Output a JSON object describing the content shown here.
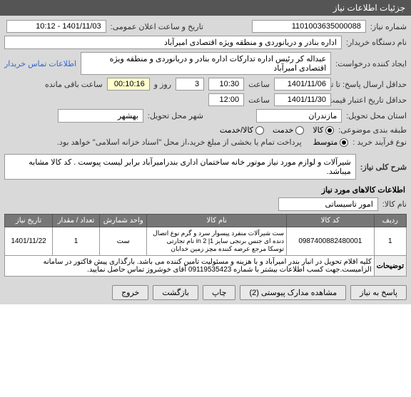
{
  "header": {
    "title": "جزئیات اطلاعات نیاز"
  },
  "form": {
    "need_number_label": "شماره نیاز:",
    "need_number_value": "1101003635000088",
    "public_announce_label": "تاریخ و ساعت اعلان عمومی:",
    "public_announce_value": "1401/11/03 - 10:12",
    "buyer_org_label": "نام دستگاه خریدار:",
    "buyer_org_value": "اداره بنادر و دریانوردی و منطقه ویژه اقتصادی امیرآباد",
    "requester_label": "ایجاد کننده درخواست:",
    "requester_value": "عبداله کر رئیس اداره تدارکات اداره بنادر و دریانوردی و منطقه ویژه اقتصادی امیرآباد",
    "buyer_contact_link": "اطلاعات تماس خریدار",
    "response_deadline_label": "حداقل ارسال پاسخ: تا تاریخ:",
    "response_date": "1401/11/06",
    "response_time_label": "ساعت",
    "response_time": "10:30",
    "days_label": "روز و",
    "days_value": "3",
    "remaining_time": "00:10:16",
    "remaining_label": "ساعت باقی مانده",
    "validity_label": "حداقل تاریخ اعتبار قیمت: تا تاریخ:",
    "validity_date": "1401/11/30",
    "validity_time_label": "ساعت",
    "validity_time": "12:00",
    "province_label": "استان محل تحویل:",
    "province_value": "مازندران",
    "city_label": "شهر محل تحویل:",
    "city_value": "بهشهر",
    "classification_label": "طبقه بندی موضوعی:",
    "radio_goods": "کالا",
    "radio_service": "خدمت",
    "radio_goods_service": "کالا/خدمت",
    "purchase_type_label": "نوع فرآیند خرید :",
    "radio_medium": "متوسط",
    "purchase_note": "پرداخت تمام یا بخشی از مبلغ خرید،از محل \"اسناد خزانه اسلامی\" خواهد بود.",
    "general_desc_label": "شرح کلی نیاز:",
    "general_desc_value": "شیرآلات و لوازم مورد نیاز موتور خانه ساختمان اداری بندرامیرآباد برابر لیست پیوست . کد کالا مشابه میباشد.",
    "goods_info_title": "اطلاعات کالاهای مورد نیاز",
    "goods_name_label": "نام کالا:",
    "goods_name_value": "امور تاسیساتی"
  },
  "table": {
    "headers": {
      "row": "ردیف",
      "code": "کد کالا",
      "name": "نام کالا",
      "unit": "واحد شمارش",
      "qty": "تعداد / مقدار",
      "need_date": "تاریخ نیاز"
    },
    "rows": [
      {
        "row": "1",
        "code": "0987400882480001",
        "name": "ست شیرآلات منفرد پیسوار سرد و گرم نوع اتصال دنده ای جنس برنجی سایز 1| 2 in نام تجارتی توسکا مرجع عرضه کننده مچز زمین خدابان",
        "unit": "ست",
        "qty": "1",
        "need_date": "1401/11/22"
      }
    ],
    "desc_label": "توضیحات",
    "desc_value": "کلیه اقلام تحویل در انبار بندر امیرآباد و با هزینه و مسئولیت تامین کننده می باشد. بارگذاری پیش فاکتور در سامانه الزامیست.جهت کسب اطلاعات بیشتر با شماره 09119535423 آقای خوشروز تماس حاصل نمایید."
  },
  "buttons": {
    "respond": "پاسخ به نیاز",
    "view_docs": "مشاهده مدارک پیوستی (2)",
    "print": "چاپ",
    "back": "بازگشت",
    "exit": "خروج"
  }
}
